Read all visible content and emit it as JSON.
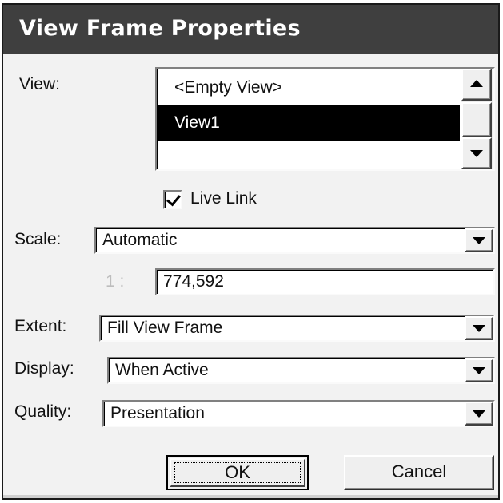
{
  "dialog": {
    "title": "View Frame Properties"
  },
  "view": {
    "label": "View:",
    "items": [
      "<Empty View>",
      "View1"
    ],
    "selected_index": 1
  },
  "live_link": {
    "label": "Live Link",
    "checked": true
  },
  "scale": {
    "label": "Scale:",
    "value": "Automatic",
    "ratio_prefix": "1 :",
    "ratio_value": "774,592"
  },
  "extent": {
    "label": "Extent:",
    "value": "Fill View Frame"
  },
  "display": {
    "label": "Display:",
    "value": "When Active"
  },
  "quality": {
    "label": "Quality:",
    "value": "Presentation"
  },
  "buttons": {
    "ok": "OK",
    "cancel": "Cancel"
  },
  "icons": {
    "scroll_up": "arrow-up-icon",
    "scroll_down": "arrow-down-icon",
    "dropdown": "chevron-down-icon",
    "check": "checkmark-icon"
  }
}
